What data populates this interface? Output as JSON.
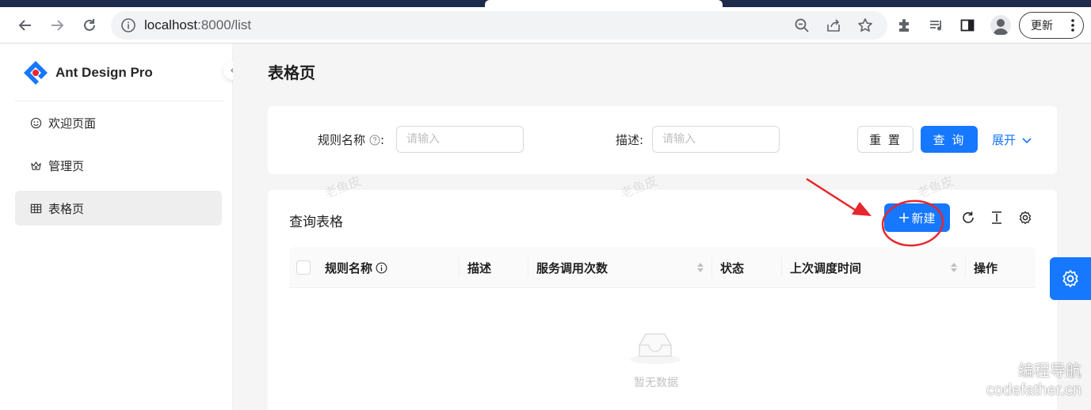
{
  "browser": {
    "url_host": "localhost",
    "url_path": ":8000/list",
    "update_label": "更新"
  },
  "app": {
    "logo_title": "Ant Design Pro",
    "menu": [
      {
        "label": "欢迎页面",
        "icon": "smile-icon"
      },
      {
        "label": "管理页",
        "icon": "crown-icon"
      },
      {
        "label": "表格页",
        "icon": "table-icon",
        "active": true
      }
    ],
    "page_title": "表格页"
  },
  "search_form": {
    "rule_name_label": "规则名称",
    "rule_name_placeholder": "请输入",
    "desc_label": "描述:",
    "desc_placeholder": "请输入",
    "reset_label": "重 置",
    "query_label": "查 询",
    "expand_label": "展开"
  },
  "table": {
    "title": "查询表格",
    "new_label": "新建",
    "columns": [
      "规则名称",
      "描述",
      "服务调用次数",
      "状态",
      "上次调度时间",
      "操作"
    ],
    "empty_text": "暂无数据"
  },
  "watermarks": [
    "老鱼皮",
    "老鱼皮",
    "老鱼皮"
  ],
  "corner_watermark": {
    "line1": "编程导航",
    "line2": "codefather.cn"
  },
  "colors": {
    "primary": "#1677ff",
    "annotation_red": "#e8262d"
  }
}
